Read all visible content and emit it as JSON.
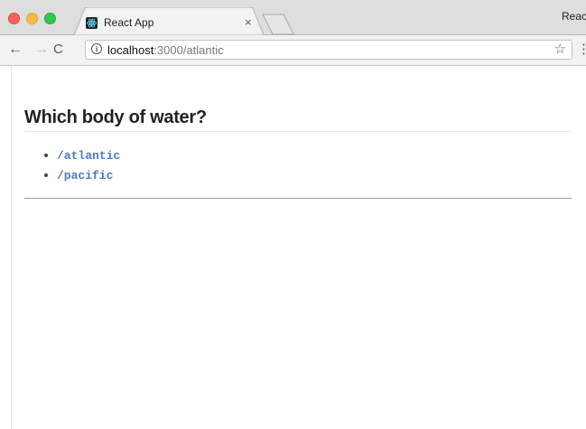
{
  "browser": {
    "tab": {
      "title": "React App",
      "close_glyph": "×",
      "favicon": "react-icon"
    },
    "profile_label": "Reac",
    "nav": {
      "back_glyph": "←",
      "forward_glyph": "→",
      "reload_glyph": "C"
    },
    "address": {
      "host": "localhost",
      "rest": ":3000/atlantic",
      "info_glyph": "i",
      "star_glyph": "☆"
    },
    "menu_glyph": "⋮"
  },
  "page": {
    "title": "Which body of water?",
    "links": [
      {
        "label": "/atlantic"
      },
      {
        "label": "/pacific"
      }
    ]
  },
  "colors": {
    "link": "#4a7bc7",
    "title": "#222222"
  }
}
